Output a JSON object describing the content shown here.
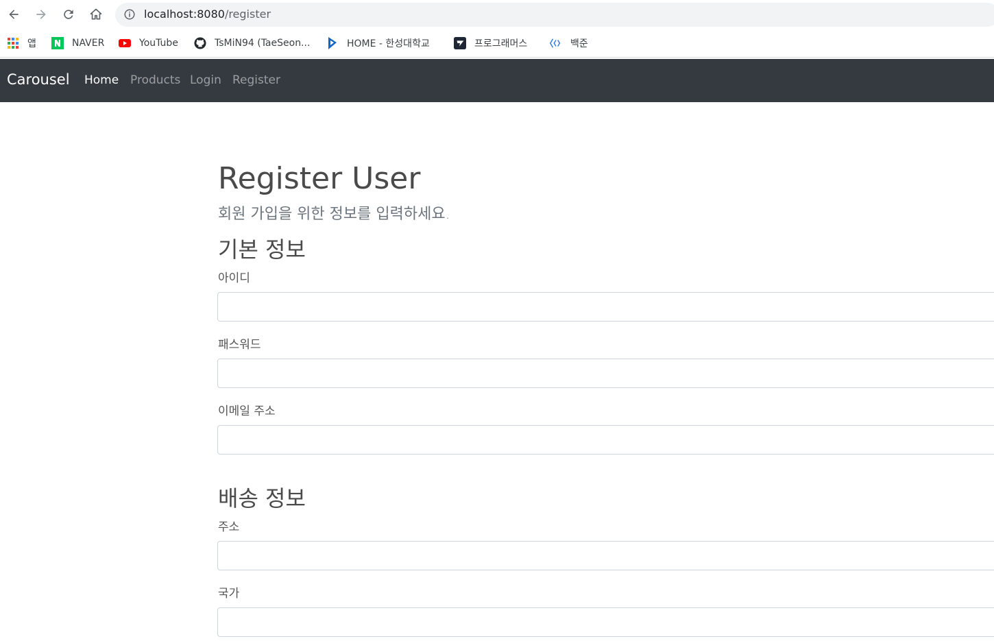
{
  "browser": {
    "url_host": "localhost:8080",
    "url_path": "/register",
    "bookmarks": [
      {
        "label": "앱",
        "icon": "apps-grid-icon"
      },
      {
        "label": "NAVER",
        "icon": "naver-icon"
      },
      {
        "label": "YouTube",
        "icon": "youtube-icon"
      },
      {
        "label": "TsMiN94 (TaeSeon...",
        "icon": "github-icon"
      },
      {
        "label": "HOME - 한성대학교",
        "icon": "hansung-icon"
      },
      {
        "label": "프로그래머스",
        "icon": "programmers-icon"
      },
      {
        "label": "백준",
        "icon": "baekjoon-icon"
      }
    ]
  },
  "navbar": {
    "brand": "Carousel",
    "links": [
      {
        "label": "Home",
        "active": true
      },
      {
        "label": "Products",
        "active": false
      },
      {
        "label": "Login",
        "active": false
      },
      {
        "label": "Register",
        "active": false
      }
    ],
    "background": "#343a40"
  },
  "page": {
    "title": "Register User",
    "subtitle": "회원 가입을 위한 정보를 입력하세요.",
    "sections": [
      {
        "heading": "기본 정보",
        "fields": [
          {
            "label": "아이디",
            "value": ""
          },
          {
            "label": "패스워드",
            "value": ""
          },
          {
            "label": "이메일 주소",
            "value": ""
          }
        ]
      },
      {
        "heading": "배송 정보",
        "fields": [
          {
            "label": "주소",
            "value": ""
          },
          {
            "label": "국가",
            "value": ""
          }
        ]
      }
    ]
  }
}
